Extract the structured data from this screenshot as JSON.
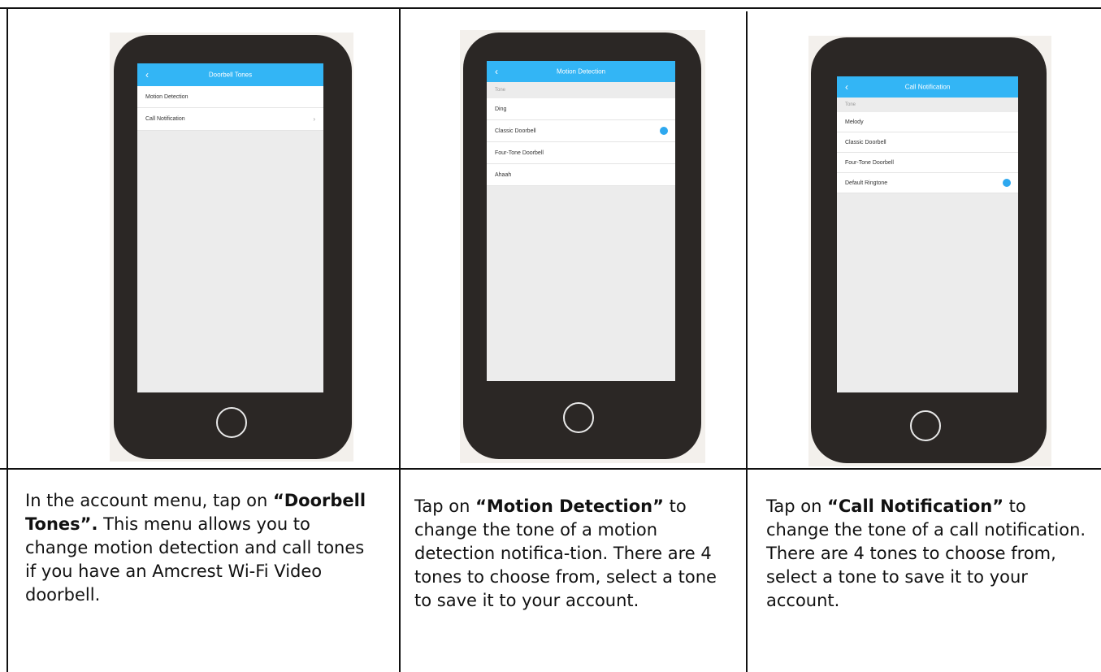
{
  "panels": [
    {
      "nav_title": "Doorbell Tones",
      "rows": [
        "Motion Detection",
        "Call Notification"
      ],
      "caption_pre": "In the account menu, tap on ",
      "caption_bold": "“Doorbell Tones”.",
      "caption_post": " This menu allows you to change motion detection and call tones if you have an Amcrest Wi-Fi Video doorbell."
    },
    {
      "nav_title": "Motion Detection",
      "section": "Tone",
      "rows": [
        "Ding",
        "Classic Doorbell",
        "Four-Tone Doorbell",
        "Ahaah"
      ],
      "caption_pre": "Tap on ",
      "caption_bold": "“Motion Detection”",
      "caption_post": " to change the tone of a motion detection notifica-tion. There are 4 tones to choose from, select a tone to save it to your account."
    },
    {
      "nav_title": "Call Notification",
      "section": "Tone",
      "rows": [
        "Melody",
        "Classic Doorbell",
        "Four-Tone Doorbell",
        "Default Ringtone"
      ],
      "caption_pre": "Tap on ",
      "caption_bold": "“Call Notification”",
      "caption_post": " to change the tone of a call notification. There are 4 tones to choose from, select a tone to save it to your account."
    }
  ],
  "icons": {
    "back": "chevron-left-icon",
    "forward": "chevron-right-icon",
    "selected": "selected-dot-icon",
    "home": "home-button-icon"
  },
  "colors": {
    "nav": "#33b5f5",
    "phone": "#2b2725",
    "selected": "#2ea8ef"
  }
}
